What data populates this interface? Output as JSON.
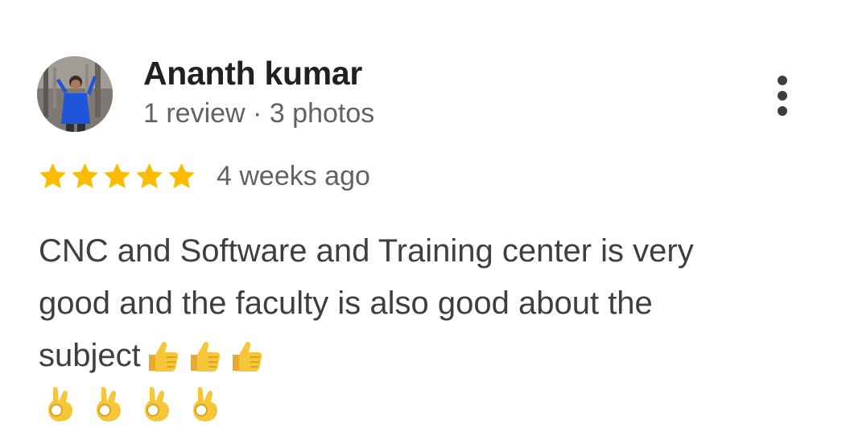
{
  "review": {
    "author_name": "Ananth kumar",
    "author_meta": "1 review · 3 photos",
    "rating": 5,
    "rating_max": 5,
    "time_ago": "4 weeks ago",
    "text_line1": "CNC and Software and Training center is very",
    "text_line2": "good and the faculty is also good about the",
    "text_line3": "subject",
    "thumbs_up_count": 3,
    "ok_hand_count": 4
  },
  "icons": {
    "avatar": "user-photo",
    "more": "more-vert-icon",
    "star": "star-icon",
    "thumbs_up": "thumbs-up-emoji",
    "ok_hand": "ok-hand-emoji"
  },
  "colors": {
    "star": "#FBBC04",
    "name": "#202124",
    "secondary": "#5f6368",
    "body_text": "#3c4043",
    "emoji": "#F6C63A"
  }
}
